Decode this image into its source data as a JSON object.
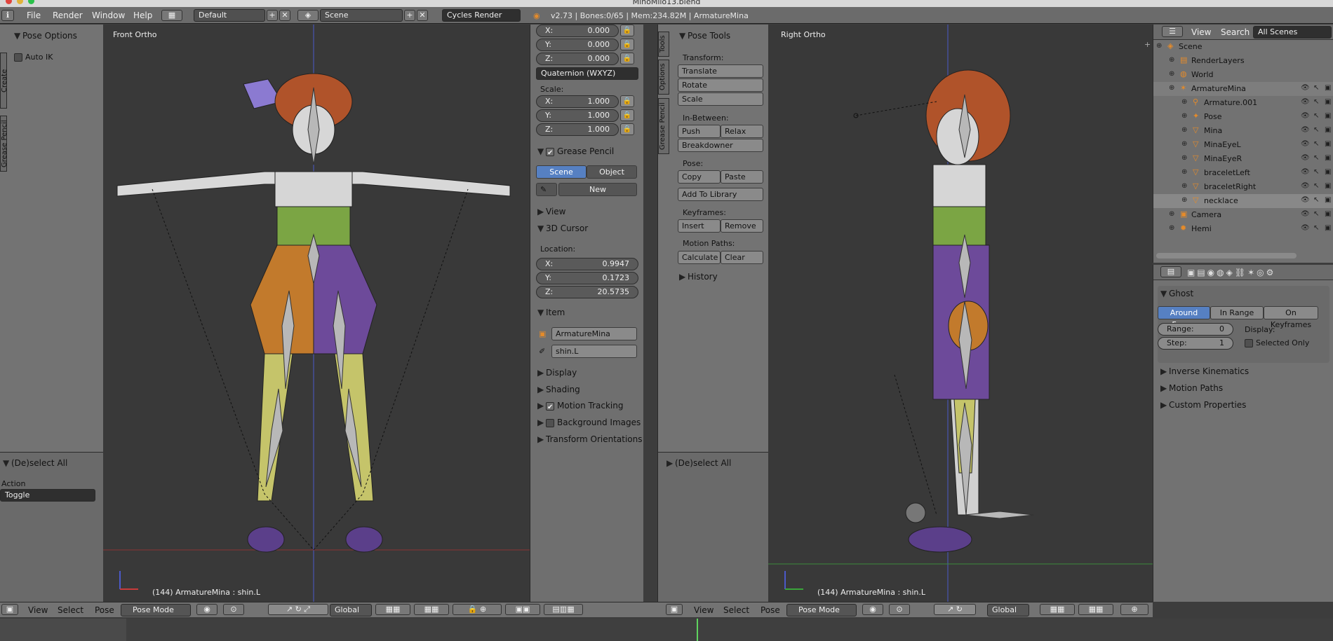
{
  "window": {
    "title": "MinoMilo13.blend"
  },
  "topbar": {
    "menus": [
      "File",
      "Render",
      "Window",
      "Help"
    ],
    "layout": "Default",
    "scene": "Scene",
    "engine": "Cycles Render",
    "info": "v2.73 | Bones:0/65 | Mem:234.82M | ArmatureMina"
  },
  "left_panel": {
    "pose_options": "Pose Options",
    "auto_ik": "Auto IK",
    "side_tabs": [
      "Create",
      "Grease Pencil"
    ],
    "op_title": "(De)select All",
    "action_label": "Action",
    "action_value": "Toggle"
  },
  "vp_left": {
    "label": "Front Ortho",
    "status": "(144) ArmatureMina : shin.L"
  },
  "vp_right": {
    "label": "Right Ortho",
    "status": "(144) ArmatureMina : shin.L"
  },
  "props": {
    "rot": [
      {
        "axis": "X:",
        "value": "0.000"
      },
      {
        "axis": "Y:",
        "value": "0.000"
      },
      {
        "axis": "Z:",
        "value": "0.000"
      }
    ],
    "rot_mode": "Quaternion (WXYZ)",
    "scale_label": "Scale:",
    "scale": [
      {
        "axis": "X:",
        "value": "1.000"
      },
      {
        "axis": "Y:",
        "value": "1.000"
      },
      {
        "axis": "Z:",
        "value": "1.000"
      }
    ],
    "grease_pencil": "Grease Pencil",
    "gp_scene": "Scene",
    "gp_object": "Object",
    "gp_new": "New",
    "view": "View",
    "cursor": "3D Cursor",
    "location": "Location:",
    "loc": [
      {
        "axis": "X:",
        "value": "0.9947"
      },
      {
        "axis": "Y:",
        "value": "0.1723"
      },
      {
        "axis": "Z:",
        "value": "20.5735"
      }
    ],
    "item": "Item",
    "item_object": "ArmatureMina",
    "item_bone": "shin.L",
    "display": "Display",
    "shading": "Shading",
    "motion_tracking": "Motion Tracking",
    "background_images": "Background Images",
    "transform_orientations": "Transform Orientations"
  },
  "tools": {
    "tabs": [
      "Tools",
      "Options",
      "Grease Pencil"
    ],
    "title": "Pose Tools",
    "transform": "Transform:",
    "translate": "Translate",
    "rotate": "Rotate",
    "scale": "Scale",
    "inbetween": "In-Between:",
    "push": "Push",
    "relax": "Relax",
    "breakdowner": "Breakdowner",
    "pose": "Pose:",
    "copy": "Copy",
    "paste": "Paste",
    "add_library": "Add To Library",
    "keyframes": "Keyframes:",
    "insert": "Insert",
    "remove": "Remove",
    "motion_paths": "Motion Paths:",
    "calculate": "Calculate",
    "clear": "Clear",
    "history": "History",
    "op_title": "(De)select All"
  },
  "header3d": {
    "view": "View",
    "select": "Select",
    "pose": "Pose",
    "mode": "Pose Mode",
    "orientation": "Global"
  },
  "outliner": {
    "view": "View",
    "search": "Search",
    "filter": "All Scenes",
    "items": [
      {
        "label": "Scene",
        "indent": 0,
        "icon": "scene-icon"
      },
      {
        "label": "RenderLayers",
        "indent": 1,
        "icon": "renderlayers-icon"
      },
      {
        "label": "World",
        "indent": 1,
        "icon": "world-icon"
      },
      {
        "label": "ArmatureMina",
        "indent": 1,
        "icon": "armature-icon"
      },
      {
        "label": "Armature.001",
        "indent": 2,
        "icon": "armature-data-icon"
      },
      {
        "label": "Pose",
        "indent": 2,
        "icon": "pose-icon"
      },
      {
        "label": "Mina",
        "indent": 2,
        "icon": "mesh-icon"
      },
      {
        "label": "MinaEyeL",
        "indent": 2,
        "icon": "mesh-icon"
      },
      {
        "label": "MinaEyeR",
        "indent": 2,
        "icon": "mesh-icon"
      },
      {
        "label": "braceletLeft",
        "indent": 2,
        "icon": "mesh-icon"
      },
      {
        "label": "braceletRight",
        "indent": 2,
        "icon": "mesh-icon"
      },
      {
        "label": "necklace",
        "indent": 2,
        "icon": "mesh-icon"
      },
      {
        "label": "Camera",
        "indent": 1,
        "icon": "camera-icon"
      },
      {
        "label": "Hemi",
        "indent": 1,
        "icon": "lamp-icon"
      }
    ]
  },
  "properties": {
    "ghost": "Ghost",
    "ghost_tabs": [
      "Around Frame",
      "In Range",
      "On Keyframes"
    ],
    "range_label": "Range:",
    "range_value": "0",
    "step_label": "Step:",
    "step_value": "1",
    "display_label": "Display:",
    "selected_only": "Selected Only",
    "sections": [
      "Inverse Kinematics",
      "Motion Paths",
      "Custom Properties"
    ]
  },
  "colors": {
    "accent": "#5680c2",
    "panel": "#737373",
    "viewport": "#393939",
    "header": "#6b6b6b"
  }
}
